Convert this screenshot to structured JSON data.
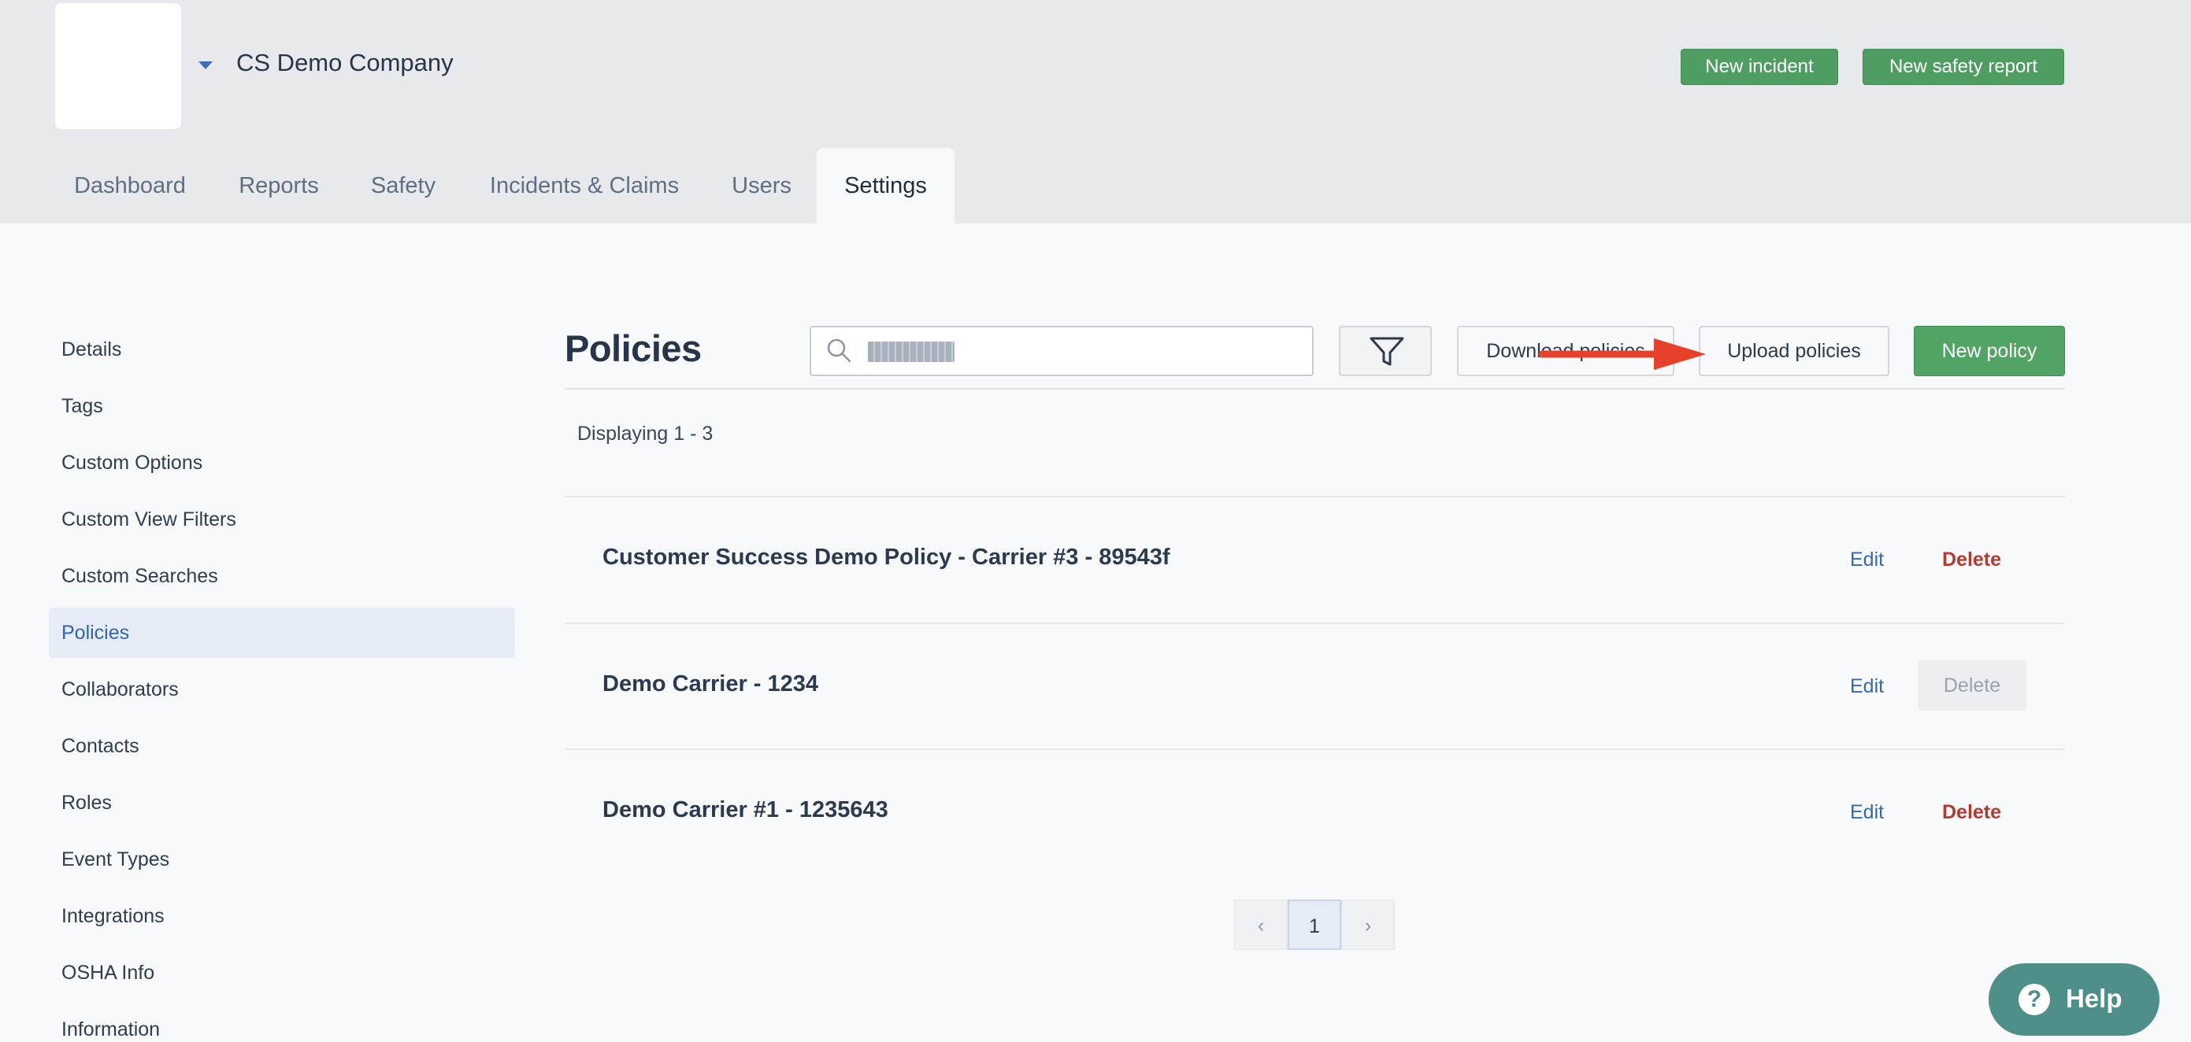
{
  "header": {
    "company_name": "CS Demo Company",
    "new_incident_label": "New incident",
    "new_safety_report_label": "New safety report"
  },
  "tabs": [
    {
      "label": "Dashboard"
    },
    {
      "label": "Reports"
    },
    {
      "label": "Safety"
    },
    {
      "label": "Incidents & Claims"
    },
    {
      "label": "Users"
    },
    {
      "label": "Settings",
      "active": true
    }
  ],
  "sidebar": {
    "items": [
      {
        "label": "Details"
      },
      {
        "label": "Tags"
      },
      {
        "label": "Custom Options"
      },
      {
        "label": "Custom View Filters"
      },
      {
        "label": "Custom Searches"
      },
      {
        "label": "Policies",
        "active": true
      },
      {
        "label": "Collaborators"
      },
      {
        "label": "Contacts"
      },
      {
        "label": "Roles"
      },
      {
        "label": "Event Types"
      },
      {
        "label": "Integrations"
      },
      {
        "label": "OSHA Info"
      },
      {
        "label": "Information"
      }
    ]
  },
  "main": {
    "title": "Policies",
    "download_label": "Download policies",
    "upload_label": "Upload policies",
    "new_policy_label": "New policy",
    "displaying": "Displaying 1 - 3",
    "policies": [
      {
        "name": "Customer Success Demo Policy - Carrier #3 - 89543f",
        "edit": "Edit",
        "delete": "Delete",
        "delete_enabled": true
      },
      {
        "name": "Demo Carrier - 1234",
        "edit": "Edit",
        "delete": "Delete",
        "delete_enabled": false
      },
      {
        "name": "Demo Carrier #1 - 1235643",
        "edit": "Edit",
        "delete": "Delete",
        "delete_enabled": true
      }
    ]
  },
  "pagination": {
    "prev": "‹",
    "current_page": "1",
    "next": "›"
  },
  "help": {
    "icon": "?",
    "label": "Help"
  },
  "colors": {
    "primary_green": "#52a465",
    "link_blue": "#3269b3",
    "delete_red": "#b53a2d",
    "annotation_arrow": "#e8412b"
  }
}
